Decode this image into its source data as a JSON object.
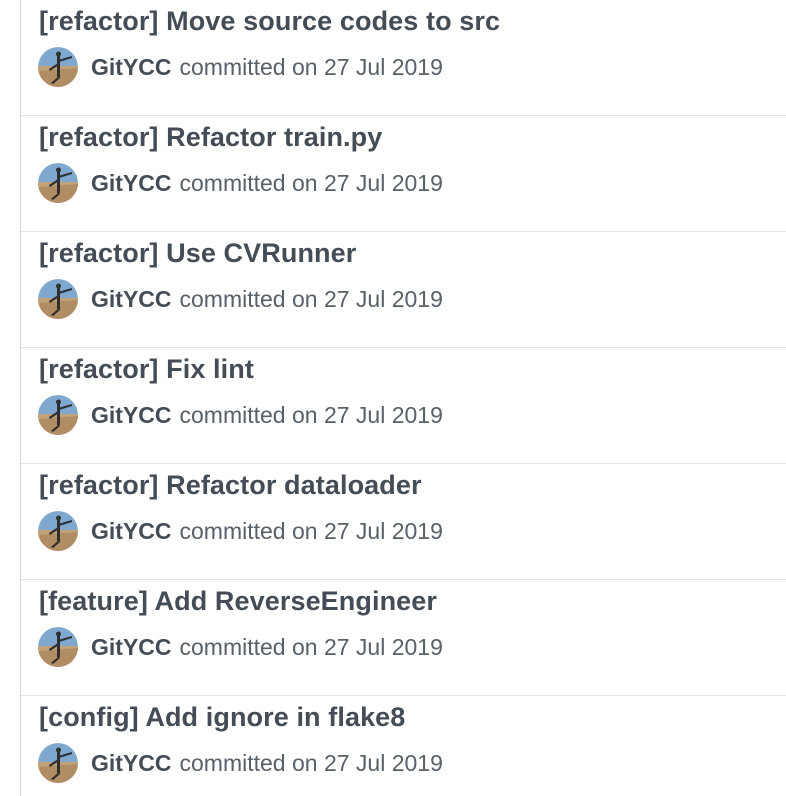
{
  "commits": [
    {
      "title": "[refactor] Move source codes to src",
      "author": "GitYCC",
      "date_text": "committed on 27 Jul 2019",
      "avatar_icon": "user-avatar-icon"
    },
    {
      "title": "[refactor] Refactor train.py",
      "author": "GitYCC",
      "date_text": "committed on 27 Jul 2019",
      "avatar_icon": "user-avatar-icon"
    },
    {
      "title": "[refactor] Use CVRunner",
      "author": "GitYCC",
      "date_text": "committed on 27 Jul 2019",
      "avatar_icon": "user-avatar-icon"
    },
    {
      "title": "[refactor] Fix lint",
      "author": "GitYCC",
      "date_text": "committed on 27 Jul 2019",
      "avatar_icon": "user-avatar-icon"
    },
    {
      "title": "[refactor] Refactor dataloader",
      "author": "GitYCC",
      "date_text": "committed on 27 Jul 2019",
      "avatar_icon": "user-avatar-icon"
    },
    {
      "title": "[feature] Add ReverseEngineer",
      "author": "GitYCC",
      "date_text": "committed on 27 Jul 2019",
      "avatar_icon": "user-avatar-icon"
    },
    {
      "title": "[config] Add ignore in flake8",
      "author": "GitYCC",
      "date_text": "committed on 27 Jul 2019",
      "avatar_icon": "user-avatar-icon"
    }
  ],
  "colors": {
    "title": "#444d56",
    "meta": "#586069",
    "divider": "#e1e4e8"
  }
}
